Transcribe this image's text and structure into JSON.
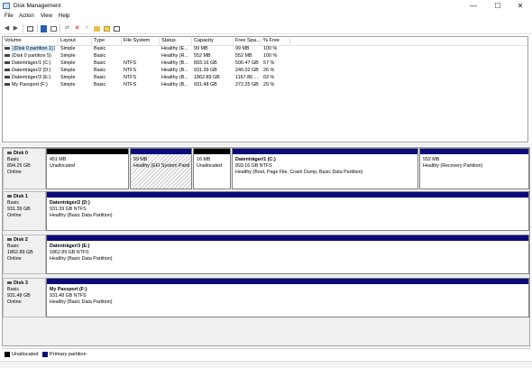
{
  "window": {
    "title": "Disk Management",
    "minimize": "—",
    "maximize": "☐",
    "close": "✕"
  },
  "menu": [
    "File",
    "Action",
    "View",
    "Help"
  ],
  "toolbar": [
    "back-icon",
    "forward-icon",
    "properties-icon",
    "help-icon",
    "refresh-icon",
    "connect-icon",
    "delete-icon",
    "check-icon",
    "folder-icon",
    "wizard-icon",
    "view-icon"
  ],
  "table": {
    "headers": [
      "Volume",
      "Layout",
      "Type",
      "File System",
      "Status",
      "Capacity",
      "Free Spa...",
      "% Free"
    ],
    "rows": [
      {
        "volume": "(Disk 0 partition 1)",
        "layout": "Simple",
        "type": "Basic",
        "fs": "",
        "status": "Healthy (E...",
        "capacity": "99 MB",
        "free": "99 MB",
        "pct": "100 %"
      },
      {
        "volume": "(Disk 0 partition 5)",
        "layout": "Simple",
        "type": "Basic",
        "fs": "",
        "status": "Healthy (R...",
        "capacity": "552 MB",
        "free": "552 MB",
        "pct": "100 %"
      },
      {
        "volume": "Datenträger/1 (C:)",
        "layout": "Simple",
        "type": "Basic",
        "fs": "NTFS",
        "status": "Healthy (B...",
        "capacity": "893.16 GB",
        "free": "506.47 GB",
        "pct": "57 %"
      },
      {
        "volume": "Datenträger/2 (D:)",
        "layout": "Simple",
        "type": "Basic",
        "fs": "NTFS",
        "status": "Healthy (B...",
        "capacity": "931.39 GB",
        "free": "240.02 GB",
        "pct": "26 %"
      },
      {
        "volume": "Datenträger/3 (E:)",
        "layout": "Simple",
        "type": "Basic",
        "fs": "NTFS",
        "status": "Healthy (B...",
        "capacity": "1862.89 GB",
        "free": "1167.86 ...",
        "pct": "63 %"
      },
      {
        "volume": "My Passport (F:)",
        "layout": "Simple",
        "type": "Basic",
        "fs": "NTFS",
        "status": "Healthy (B...",
        "capacity": "931.48 GB",
        "free": "272.25 GB",
        "pct": "29 %"
      }
    ]
  },
  "disks": [
    {
      "name": "Disk 0",
      "type": "Basic",
      "size": "894.25 GB",
      "state": "Online",
      "parts": [
        {
          "kind": "un",
          "name": "",
          "l1": "451 MB",
          "l2": "Unallocated"
        },
        {
          "kind": "pr",
          "name": "",
          "l1": "99 MB",
          "l2": "Healthy (EFI System Partition)",
          "hatch": true
        },
        {
          "kind": "un",
          "name": "",
          "l1": "16 MB",
          "l2": "Unallocated"
        },
        {
          "kind": "pr",
          "name": "Datenträger/1  (C:)",
          "l1": "893.16 GB NTFS",
          "l2": "Healthy (Boot, Page File, Crash Dump, Basic Data Partition)"
        },
        {
          "kind": "pr",
          "name": "",
          "l1": "552 MB",
          "l2": "Healthy (Recovery Partition)"
        }
      ]
    },
    {
      "name": "Disk 1",
      "type": "Basic",
      "size": "931.39 GB",
      "state": "Online",
      "parts": [
        {
          "kind": "pr",
          "name": "Datenträger/2  (D:)",
          "l1": "931.39 GB NTFS",
          "l2": "Healthy (Basic Data Partition)"
        }
      ]
    },
    {
      "name": "Disk 2",
      "type": "Basic",
      "size": "1862.89 GB",
      "state": "Online",
      "parts": [
        {
          "kind": "pr",
          "name": "Datenträger/3  (E:)",
          "l1": "1862.89 GB NTFS",
          "l2": "Healthy (Basic Data Partition)"
        }
      ]
    },
    {
      "name": "Disk 3",
      "type": "Basic",
      "size": "931.48 GB",
      "state": "Online",
      "parts": [
        {
          "kind": "pr",
          "name": "My Passport  (F:)",
          "l1": "931.48 GB NTFS",
          "l2": "Healthy (Basic Data Partition)"
        }
      ]
    }
  ],
  "legend": [
    {
      "label": "Unallocated",
      "color": "#000000"
    },
    {
      "label": "Primary partition",
      "color": "#0a0a7a"
    }
  ]
}
